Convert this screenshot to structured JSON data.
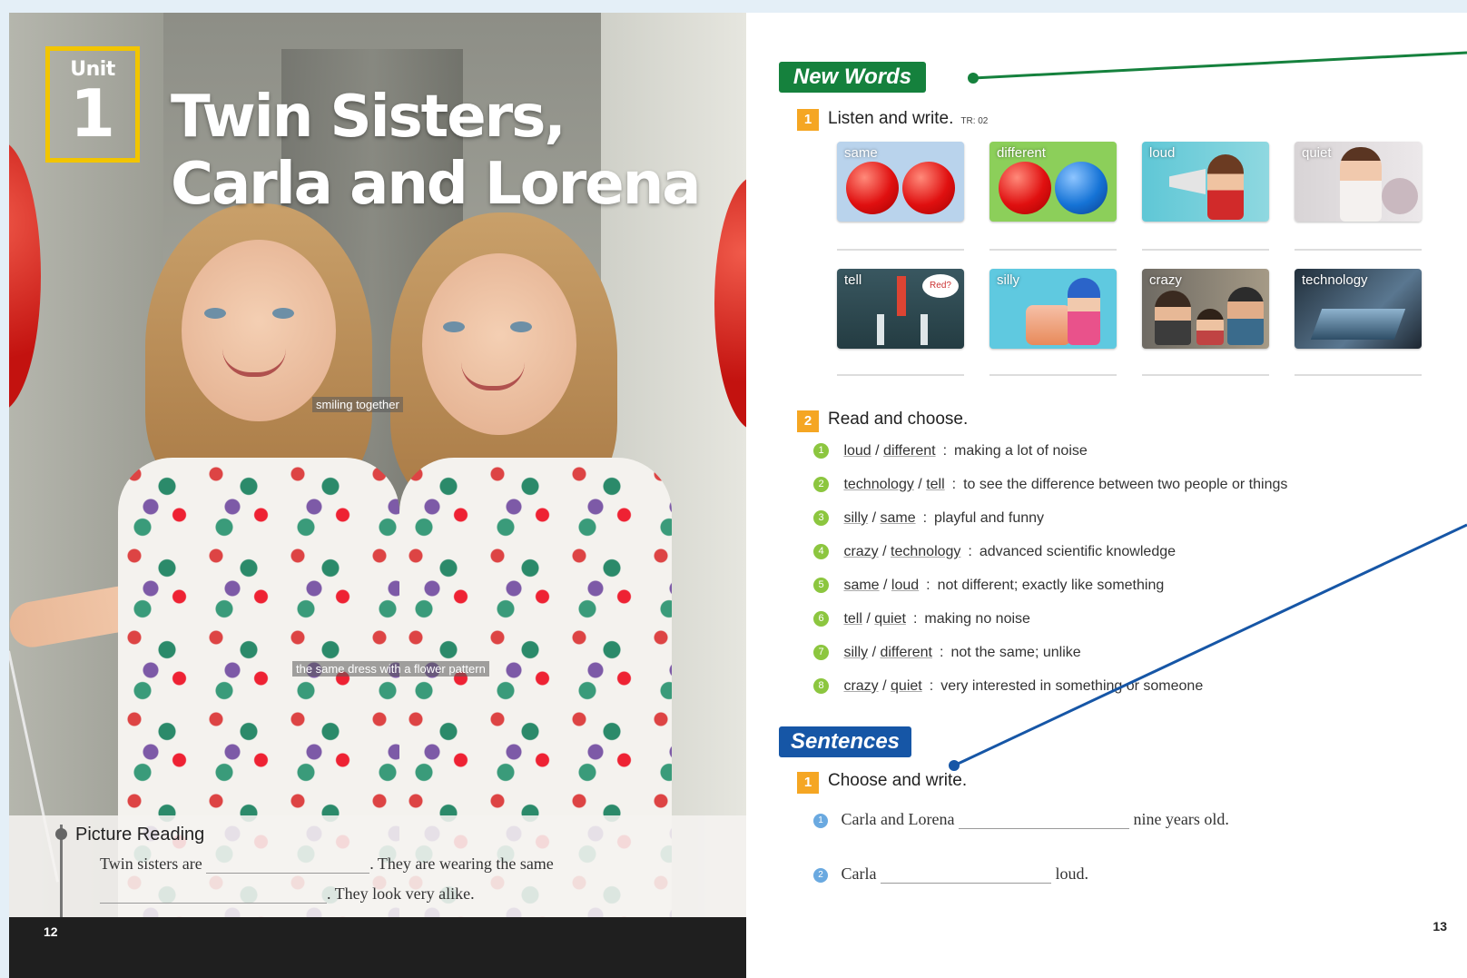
{
  "left_page": {
    "unit_word": "Unit",
    "unit_number": "1",
    "title_line1": "Twin Sisters,",
    "title_line2": "Carla and Lorena",
    "photo_labels": {
      "smiling": "smiling together",
      "dress": "the same dress with a flower pattern"
    },
    "picture_reading": {
      "title": "Picture Reading",
      "text_part1": "Twin sisters are",
      "text_part2": ". They are wearing the same",
      "text_part3": ". They look very alike."
    },
    "page_number": "12"
  },
  "right_page": {
    "new_words": {
      "label": "New Words",
      "step1_number": "1",
      "step1_text": "Listen and write.",
      "step1_track": "TR: 02",
      "cards": [
        {
          "label": "same"
        },
        {
          "label": "different"
        },
        {
          "label": "loud"
        },
        {
          "label": "quiet"
        },
        {
          "label": "tell",
          "bubble": "Red?"
        },
        {
          "label": "silly"
        },
        {
          "label": "crazy"
        },
        {
          "label": "technology"
        }
      ],
      "step2_number": "2",
      "step2_text": "Read and choose.",
      "read_choose": [
        {
          "n": "1",
          "a": "loud",
          "b": "different",
          "def": "making a lot of noise"
        },
        {
          "n": "2",
          "a": "technology",
          "b": "tell",
          "def": "to see the difference between two people or things"
        },
        {
          "n": "3",
          "a": "silly",
          "b": "same",
          "def": "playful and funny"
        },
        {
          "n": "4",
          "a": "crazy",
          "b": "technology",
          "def": "advanced scientific knowledge"
        },
        {
          "n": "5",
          "a": "same",
          "b": "loud",
          "def": "not different; exactly like something"
        },
        {
          "n": "6",
          "a": "tell",
          "b": "quiet",
          "def": "making no noise"
        },
        {
          "n": "7",
          "a": "silly",
          "b": "different",
          "def": "not the same; unlike"
        },
        {
          "n": "8",
          "a": "crazy",
          "b": "quiet",
          "def": "very interested in something or someone"
        }
      ]
    },
    "sentences": {
      "label": "Sentences",
      "step1_number": "1",
      "step1_text": "Choose and write.",
      "items": [
        {
          "n": "1",
          "before": "Carla and Lorena",
          "after": "nine years old."
        },
        {
          "n": "2",
          "before": "Carla",
          "after": "loud."
        }
      ]
    },
    "page_number": "13"
  },
  "colors": {
    "new_words_green": "#15813d",
    "sentences_blue": "#1656a6",
    "step_orange": "#f5a623",
    "unit_yellow": "#f2c500"
  }
}
